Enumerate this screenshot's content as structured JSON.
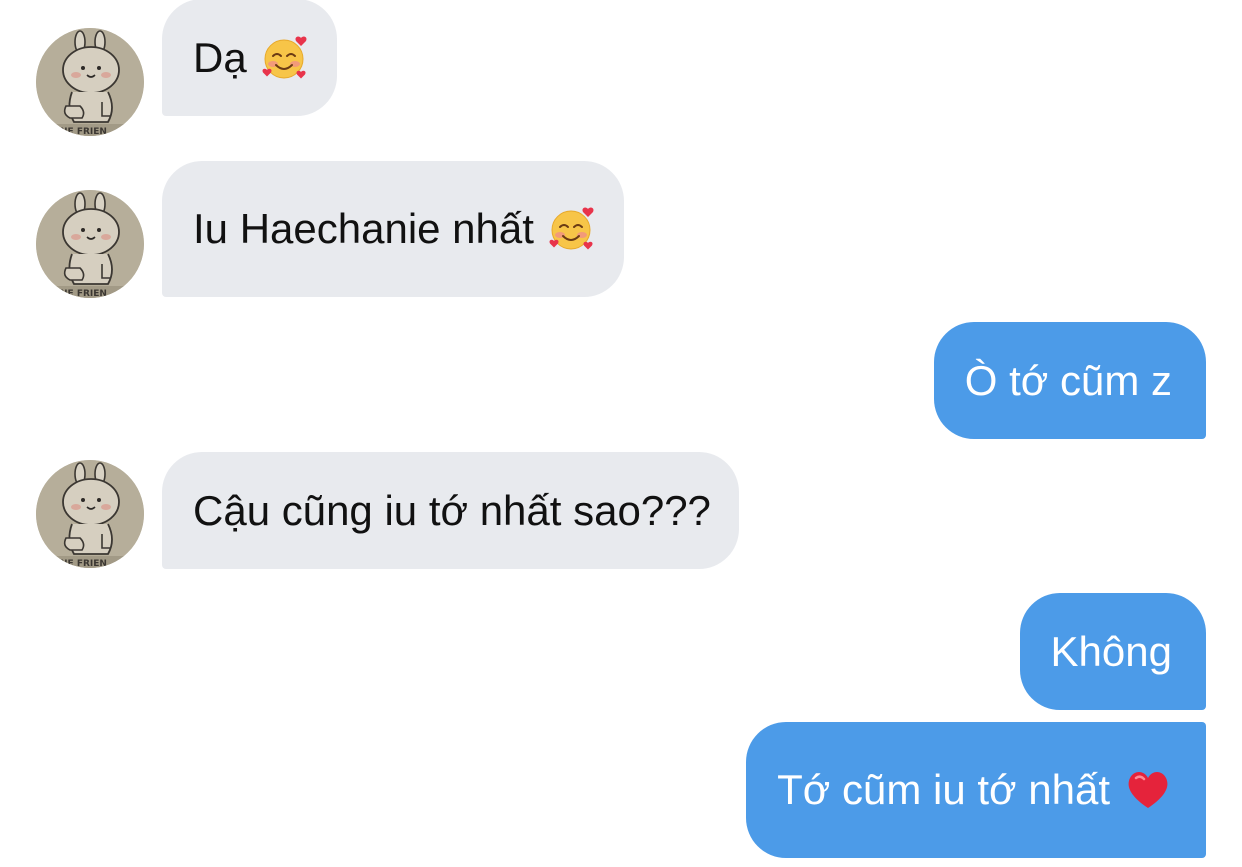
{
  "conversation": {
    "messages": [
      {
        "sender": "other",
        "text": "Dạ",
        "emoji": "smiling-face-with-hearts-icon"
      },
      {
        "sender": "other",
        "text": "Iu Haechanie nhất",
        "emoji": "smiling-face-with-hearts-icon"
      },
      {
        "sender": "me",
        "text": "Ò tớ cũm z"
      },
      {
        "sender": "other",
        "text": "Cậu cũng iu tớ nhất sao???"
      },
      {
        "sender": "me",
        "text": "Không"
      },
      {
        "sender": "me",
        "text": "Tớ cũm iu tớ nhất",
        "emoji": "red-heart-icon"
      }
    ],
    "colors": {
      "incoming_bubble": "#e8eaee",
      "outgoing_bubble": "#4c9be8",
      "incoming_text": "#111111",
      "outgoing_text": "#ffffff"
    }
  }
}
